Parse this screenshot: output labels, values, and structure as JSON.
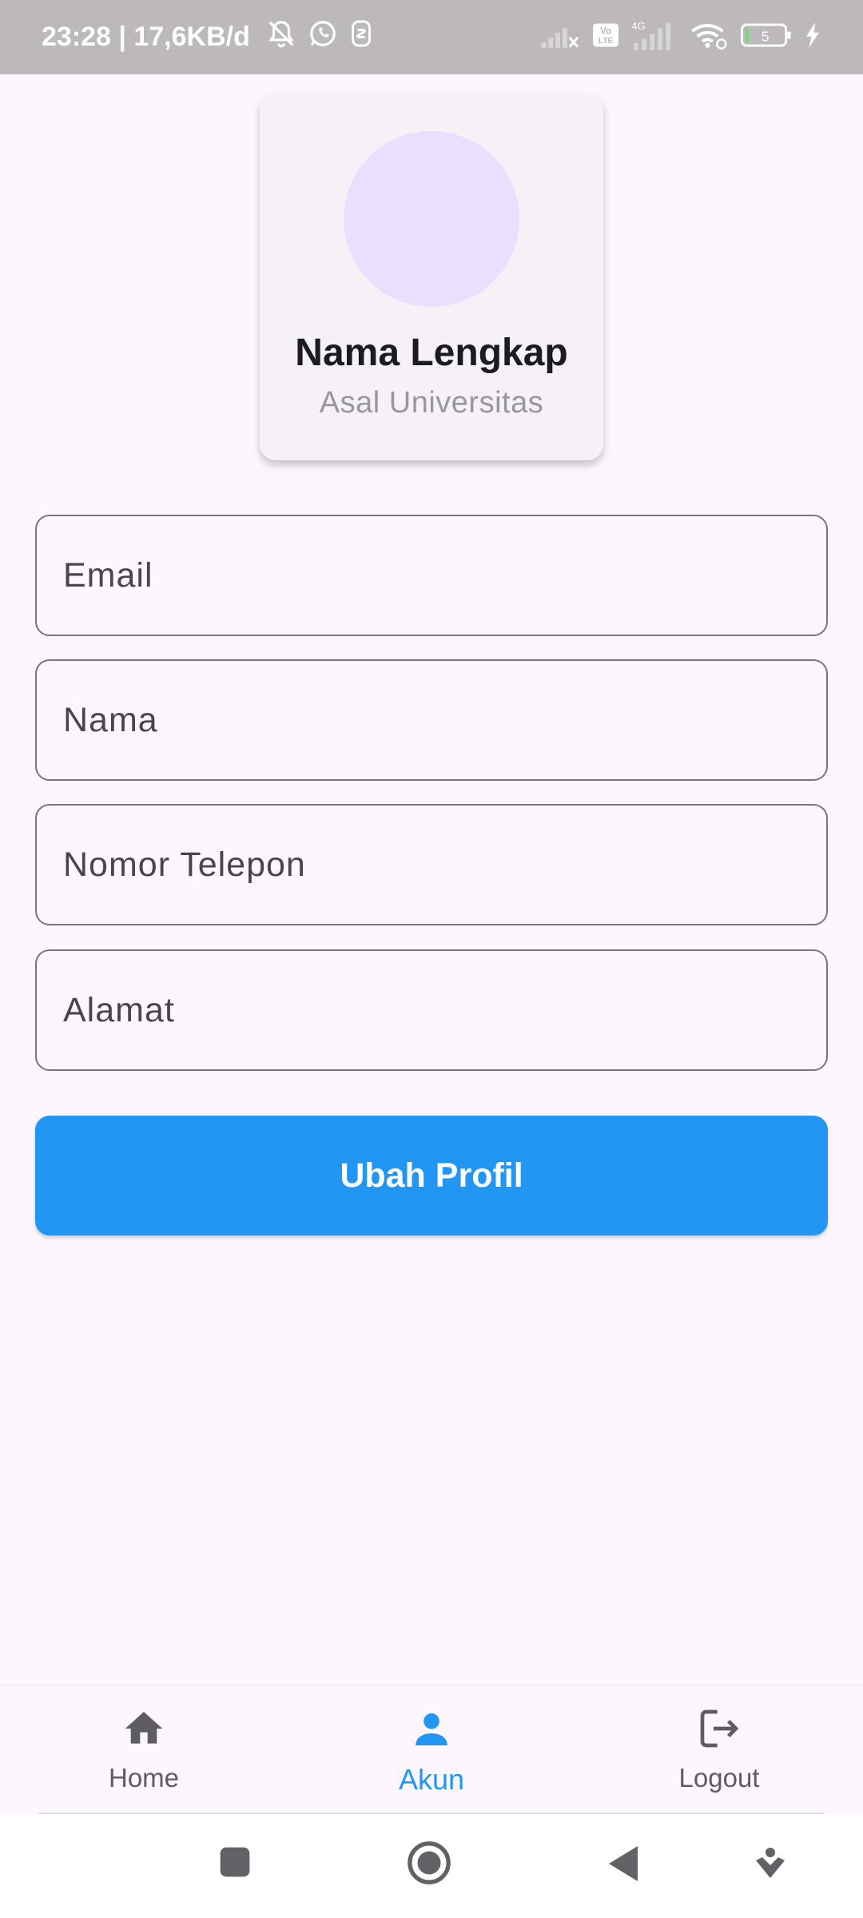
{
  "status_bar": {
    "time_speed": "23:28 | 17,6KB/d",
    "network_type": "4G",
    "volte": "Vo LTE",
    "battery_level": "5",
    "icons": [
      "mute-bell-icon",
      "whatsapp-icon",
      "app-notification-icon",
      "signal-off-icon",
      "volte-icon",
      "signal-icon",
      "wifi-icon",
      "battery-icon",
      "charging-icon"
    ]
  },
  "profile": {
    "name": "Nama Lengkap",
    "university": "Asal Universitas",
    "avatar_color": "#eadfff"
  },
  "form": {
    "email_placeholder": "Email",
    "name_placeholder": "Nama",
    "phone_placeholder": "Nomor Telepon",
    "address_placeholder": "Alamat",
    "submit_label": "Ubah Profil",
    "accent_color": "#2196f3"
  },
  "bottom_nav": {
    "items": [
      {
        "label": "Home",
        "icon": "home-icon",
        "active": false
      },
      {
        "label": "Akun",
        "icon": "person-icon",
        "active": true
      },
      {
        "label": "Logout",
        "icon": "logout-icon",
        "active": false
      }
    ]
  },
  "system_nav": {
    "icons": [
      "recents-icon",
      "home-circle-icon",
      "back-icon",
      "assistant-icon"
    ]
  }
}
